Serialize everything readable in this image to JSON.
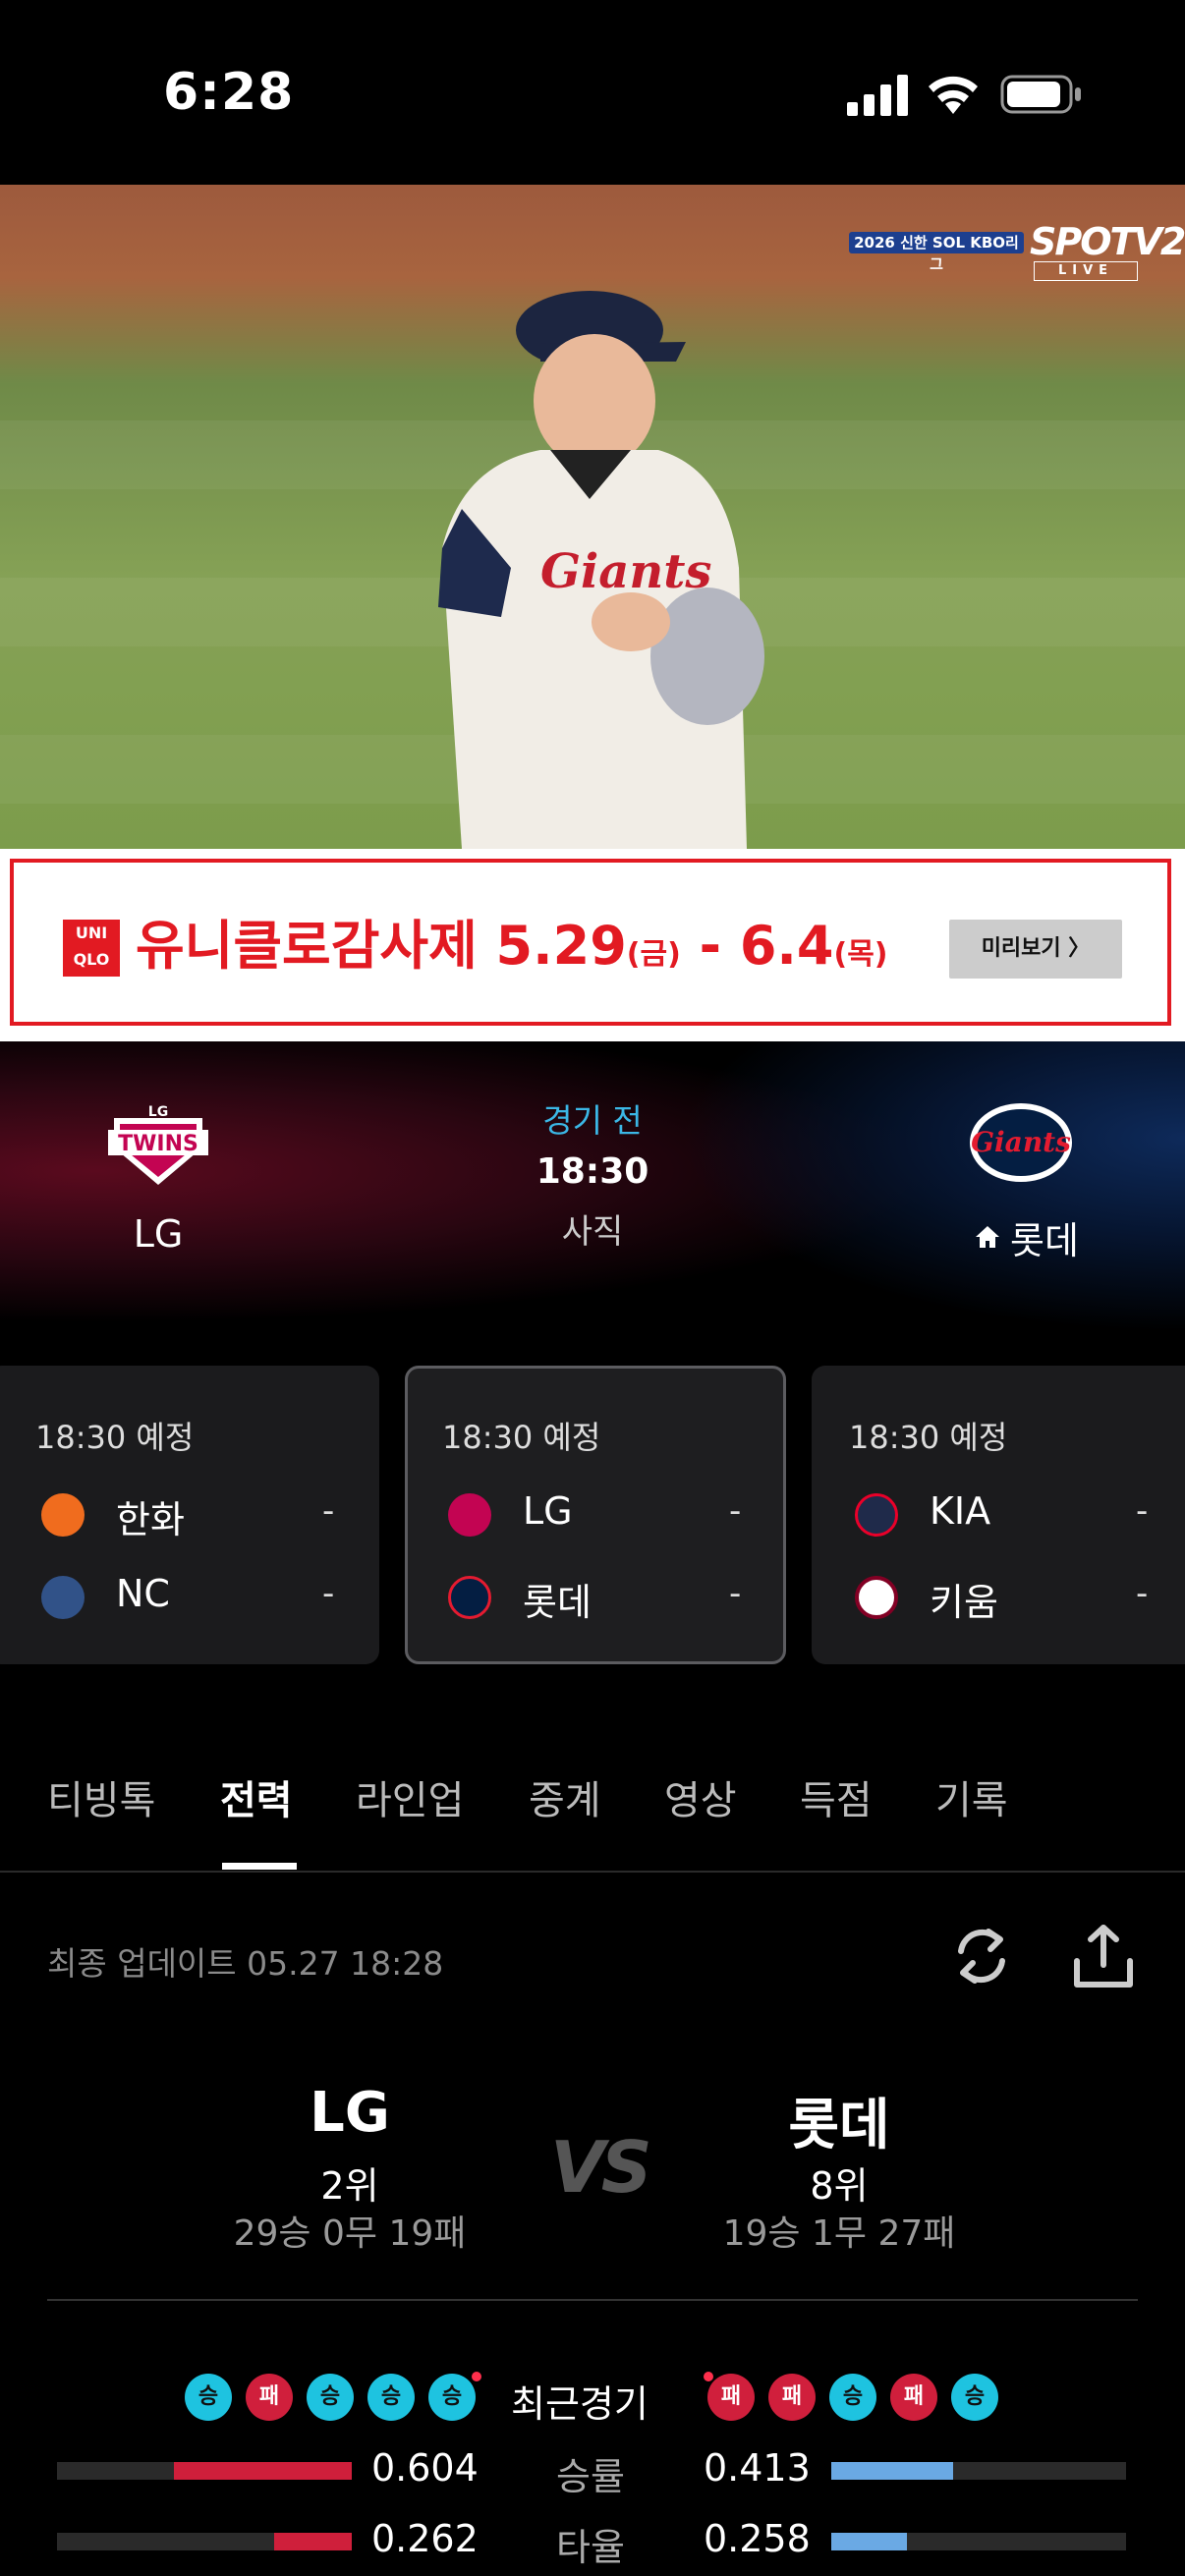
{
  "status_bar": {
    "time": "6:28"
  },
  "video": {
    "league_badge": "2026 신한 SOL KBO리그",
    "channel": "SPOTV2",
    "live": "LIVE"
  },
  "ad": {
    "brand": "UNI QLO",
    "brand_line1": "UNI",
    "brand_line2": "QLO",
    "headline": "유니클로감사제 5.29",
    "day1": "(금)",
    "dash": " - 6.4",
    "day2": "(목)",
    "button": "미리보기 〉"
  },
  "match": {
    "status": "경기 전",
    "time": "18:30",
    "venue": "사직",
    "away": {
      "name": "LG",
      "logo": "TWINS"
    },
    "home": {
      "name": "롯데",
      "logo": "Giants",
      "home_icon": "house-icon"
    }
  },
  "schedule": [
    {
      "time": "18:30 예정",
      "teams": [
        {
          "name": "한화",
          "score": "-"
        },
        {
          "name": "NC",
          "score": "-"
        }
      ]
    },
    {
      "time": "18:30 예정",
      "teams": [
        {
          "name": "LG",
          "score": "-"
        },
        {
          "name": "롯데",
          "score": "-"
        }
      ]
    },
    {
      "time": "18:30 예정",
      "teams": [
        {
          "name": "KIA",
          "score": "-"
        },
        {
          "name": "키움",
          "score": "-"
        }
      ]
    }
  ],
  "tabs": [
    {
      "label": "티빙톡"
    },
    {
      "label": "전력"
    },
    {
      "label": "라인업"
    },
    {
      "label": "중계"
    },
    {
      "label": "영상"
    },
    {
      "label": "득점"
    },
    {
      "label": "기록"
    }
  ],
  "updated": "최종 업데이트 05.27 18:28",
  "versus": {
    "left": {
      "name": "LG",
      "rank": "2위",
      "record": "29승 0무 19패"
    },
    "right": {
      "name": "롯데",
      "rank": "8위",
      "record": "19승 1무 27패"
    },
    "vs": "VS"
  },
  "recent": {
    "label": "최근경기",
    "left": [
      "승",
      "패",
      "승",
      "승",
      "승"
    ],
    "right": [
      "패",
      "패",
      "승",
      "패",
      "승"
    ]
  },
  "stats": [
    {
      "label": "승률",
      "left": "0.604",
      "right": "0.413",
      "left_fill": 0.604,
      "right_fill": 0.413
    },
    {
      "label": "타율",
      "left": "0.262",
      "right": "0.258",
      "left_fill": 0.262,
      "right_fill": 0.258
    }
  ],
  "colors": {
    "accent": "#3bb7e6",
    "win": "#1ec3e0",
    "loss": "#d01f3c",
    "brand_red": "#e21a22"
  }
}
